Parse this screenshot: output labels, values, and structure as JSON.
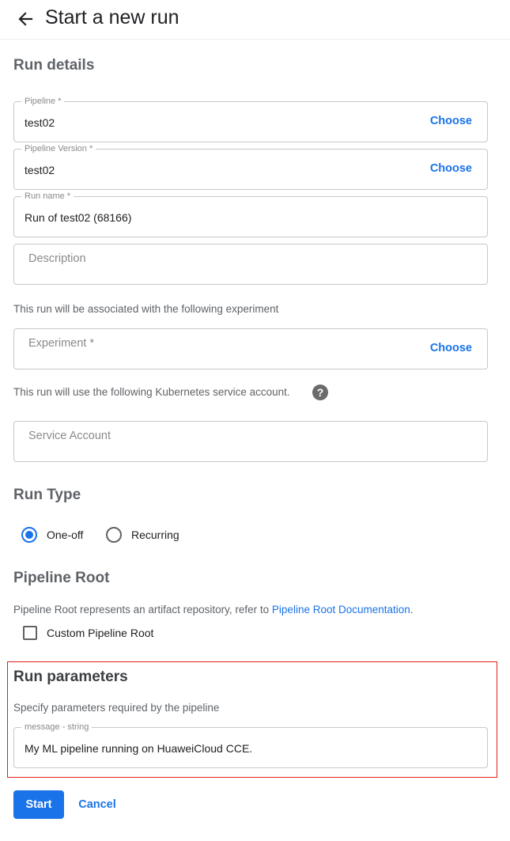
{
  "header": {
    "title": "Start a new run",
    "back_icon": "arrow-left-icon"
  },
  "run_details": {
    "title": "Run details",
    "pipeline": {
      "label": "Pipeline *",
      "value": "test02",
      "action": "Choose"
    },
    "pipeline_version": {
      "label": "Pipeline Version *",
      "value": "test02",
      "action": "Choose"
    },
    "run_name": {
      "label": "Run name *",
      "value": "Run of test02 (68166)"
    },
    "description": {
      "placeholder": "Description"
    },
    "experiment_helper": "This run will be associated with the following experiment",
    "experiment": {
      "placeholder": "Experiment *",
      "action": "Choose"
    },
    "service_account_helper": "This run will use the following Kubernetes service account.",
    "help_icon": "?",
    "service_account": {
      "placeholder": "Service Account"
    }
  },
  "run_type": {
    "title": "Run Type",
    "options": [
      "One-off",
      "Recurring"
    ],
    "selected": "One-off"
  },
  "pipeline_root": {
    "title": "Pipeline Root",
    "helper_prefix": "Pipeline Root represents an artifact repository, refer to ",
    "helper_link": "Pipeline Root Documentation",
    "helper_suffix": ".",
    "checkbox_label": "Custom Pipeline Root"
  },
  "run_parameters": {
    "title": "Run parameters",
    "helper": "Specify parameters required by the pipeline",
    "message": {
      "label": "message - string",
      "value": "My ML pipeline running on HuaweiCloud CCE."
    }
  },
  "actions": {
    "start": "Start",
    "cancel": "Cancel"
  },
  "colors": {
    "accent": "#1a73e8",
    "highlight": "#e0201a"
  }
}
